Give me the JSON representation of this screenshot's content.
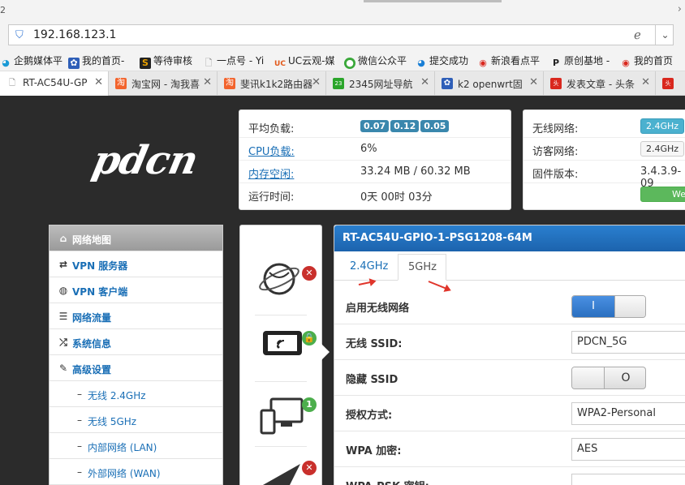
{
  "browser": {
    "tab_count_prefix": "2",
    "address": "192.168.123.1",
    "bookmarks": [
      {
        "label": "企鹅媒体平",
        "icon": "penguin-icon",
        "color": "#1a9ad6"
      },
      {
        "label": "我的首页-",
        "icon": "paw-icon",
        "color": "#2f5fb8"
      },
      {
        "label": "等待审核",
        "icon": "s-logo-icon",
        "color": "#e8a000"
      },
      {
        "label": "一点号 - Yi",
        "icon": "page-icon",
        "color": "#888888"
      },
      {
        "label": "UC云观-媒",
        "icon": "uc-icon",
        "color": "#e25a1c"
      },
      {
        "label": "微信公众平",
        "icon": "wechat-icon",
        "color": "#3aa83a"
      },
      {
        "label": "提交成功",
        "icon": "penguin-icon",
        "color": "#1a7fd6"
      },
      {
        "label": "新浪看点平",
        "icon": "weibo-icon",
        "color": "#d9281e"
      },
      {
        "label": "原创基地 -",
        "icon": "p-logo-icon",
        "color": "#222222"
      },
      {
        "label": "我的首页",
        "icon": "weibo-icon",
        "color": "#d9281e"
      }
    ],
    "tabs": [
      {
        "label": "RT-AC54U-GP",
        "icon": "page-icon",
        "color": "#888888",
        "active": true
      },
      {
        "label": "淘宝网 - 淘我喜",
        "icon": "taobao-icon",
        "color": "#f2632c"
      },
      {
        "label": "斐讯k1k2路由器",
        "icon": "taobao-icon",
        "color": "#f2632c"
      },
      {
        "label": "2345网址导航",
        "icon": "nav-2345-icon",
        "color": "#2aa52a"
      },
      {
        "label": "k2 openwrt固",
        "icon": "paw-icon",
        "color": "#2f5fb8"
      },
      {
        "label": "发表文章 - 头条",
        "icon": "toutiao-icon",
        "color": "#d9281e"
      },
      {
        "label": "",
        "icon": "toutiao-icon",
        "color": "#d9281e"
      }
    ]
  },
  "logo": {
    "text": "pdcn"
  },
  "status": {
    "load_label": "平均负载:",
    "load_values": [
      "0.07",
      "0.12",
      "0.05"
    ],
    "cpu_label": "CPU负载:",
    "cpu_value": "6%",
    "mem_label": "内存空闲:",
    "mem_value": "33.24 MB / 60.32 MB",
    "uptime_label": "运行时间:",
    "uptime_value": "0天 00时 03分"
  },
  "status_right": {
    "wifi_label": "无线网络:",
    "wifi_value": "2.4GHz",
    "guest_label": "访客网络:",
    "guest_value": "2.4GHz",
    "firmware_label": "固件版本:",
    "firmware_value": "3.4.3.9-09",
    "web_button": "Web"
  },
  "sidebar": {
    "items": [
      {
        "label": "网络地图",
        "icon": "home-icon",
        "head": true
      },
      {
        "label": "VPN 服务器",
        "icon": "swap-icon"
      },
      {
        "label": "VPN 客户端",
        "icon": "globe-icon"
      },
      {
        "label": "网络流量",
        "icon": "list-icon"
      },
      {
        "label": "系统信息",
        "icon": "shuffle-icon"
      },
      {
        "label": "高级设置",
        "icon": "wrench-icon"
      },
      {
        "label": "无线 2.4GHz",
        "icon": "dash-icon",
        "sub": true
      },
      {
        "label": "无线 5GHz",
        "icon": "dash-icon",
        "sub": true
      },
      {
        "label": "内部网络 (LAN)",
        "icon": "dash-icon",
        "sub": true
      },
      {
        "label": "外部网络 (WAN)",
        "icon": "dash-icon",
        "sub": true
      }
    ]
  },
  "main": {
    "title": "RT-AC54U-GPIO-1-PSG1208-64M",
    "tabs": [
      {
        "label": "2.4GHz"
      },
      {
        "label": "5GHz",
        "active": true
      }
    ],
    "fields": {
      "enable_label": "启用无线网络",
      "enable_state": "I",
      "ssid_label": "无线 SSID:",
      "ssid_value": "PDCN_5G",
      "hide_label": "隐藏 SSID",
      "hide_state": "O",
      "auth_label": "授权方式:",
      "auth_value": "WPA2-Personal",
      "enc_label": "WPA 加密:",
      "enc_value": "AES",
      "psk_label": "WPA-PSK 密钥:"
    }
  },
  "colors": {
    "accent_blue": "#1c63ad",
    "link_blue": "#1a6fb6",
    "badge_blue": "#3a87ad",
    "alert_red": "#c9302c",
    "ok_green": "#4cae4c",
    "arrow_red": "#e0352b"
  }
}
